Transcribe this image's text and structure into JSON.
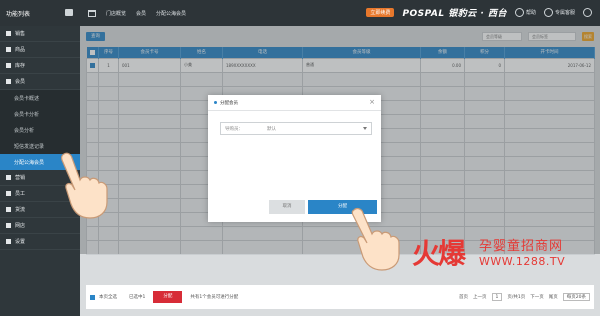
{
  "app": {
    "title": "功能列表"
  },
  "topbar": {
    "crumbs": [
      "门店概览",
      "会员",
      "分配公海会员"
    ],
    "badge": "立即续费",
    "brand": "POSPAL 银豹云 · 西台",
    "help": "帮助",
    "service": "专属客服"
  },
  "sidebar": {
    "items": [
      {
        "label": "销售"
      },
      {
        "label": "商品"
      },
      {
        "label": "库存"
      },
      {
        "label": "会员"
      }
    ],
    "subitems": [
      {
        "label": "会员卡概述"
      },
      {
        "label": "会员卡分析"
      },
      {
        "label": "会员分析"
      },
      {
        "label": "短信发送记录"
      },
      {
        "label": "分配公海会员"
      }
    ],
    "items2": [
      {
        "label": "营销"
      },
      {
        "label": "员工"
      },
      {
        "label": "货流"
      },
      {
        "label": "网店"
      },
      {
        "label": "设置"
      }
    ]
  },
  "toolbar": {
    "query_label": "查询",
    "filter1": "会员等级",
    "filter2": "会员标签",
    "action": "搜索"
  },
  "table": {
    "headers": [
      "",
      "序号",
      "会员卡号",
      "姓名",
      "电话",
      "会员等级",
      "余额",
      "积分",
      "开卡时间"
    ],
    "row": [
      "",
      "1",
      "001",
      "小美",
      "189XXXXXXXX",
      "普通",
      "0.00",
      "0",
      "2017-06-12"
    ]
  },
  "footer": {
    "select_all": "本页全选",
    "selected": "已选中1",
    "assign": "分配",
    "hint": "共有1个会员可进行分配",
    "pager": [
      "首页",
      "上一页",
      "1",
      "页/共1页",
      "下一页",
      "尾页",
      "每页20条"
    ]
  },
  "modal": {
    "title": "分配会员",
    "field_label": "导购员：",
    "field_value": "默认",
    "cancel": "取消",
    "ok": "分配"
  },
  "watermark": {
    "brand": "火爆",
    "title": "孕婴童招商网",
    "url": "WWW.1288.TV"
  }
}
